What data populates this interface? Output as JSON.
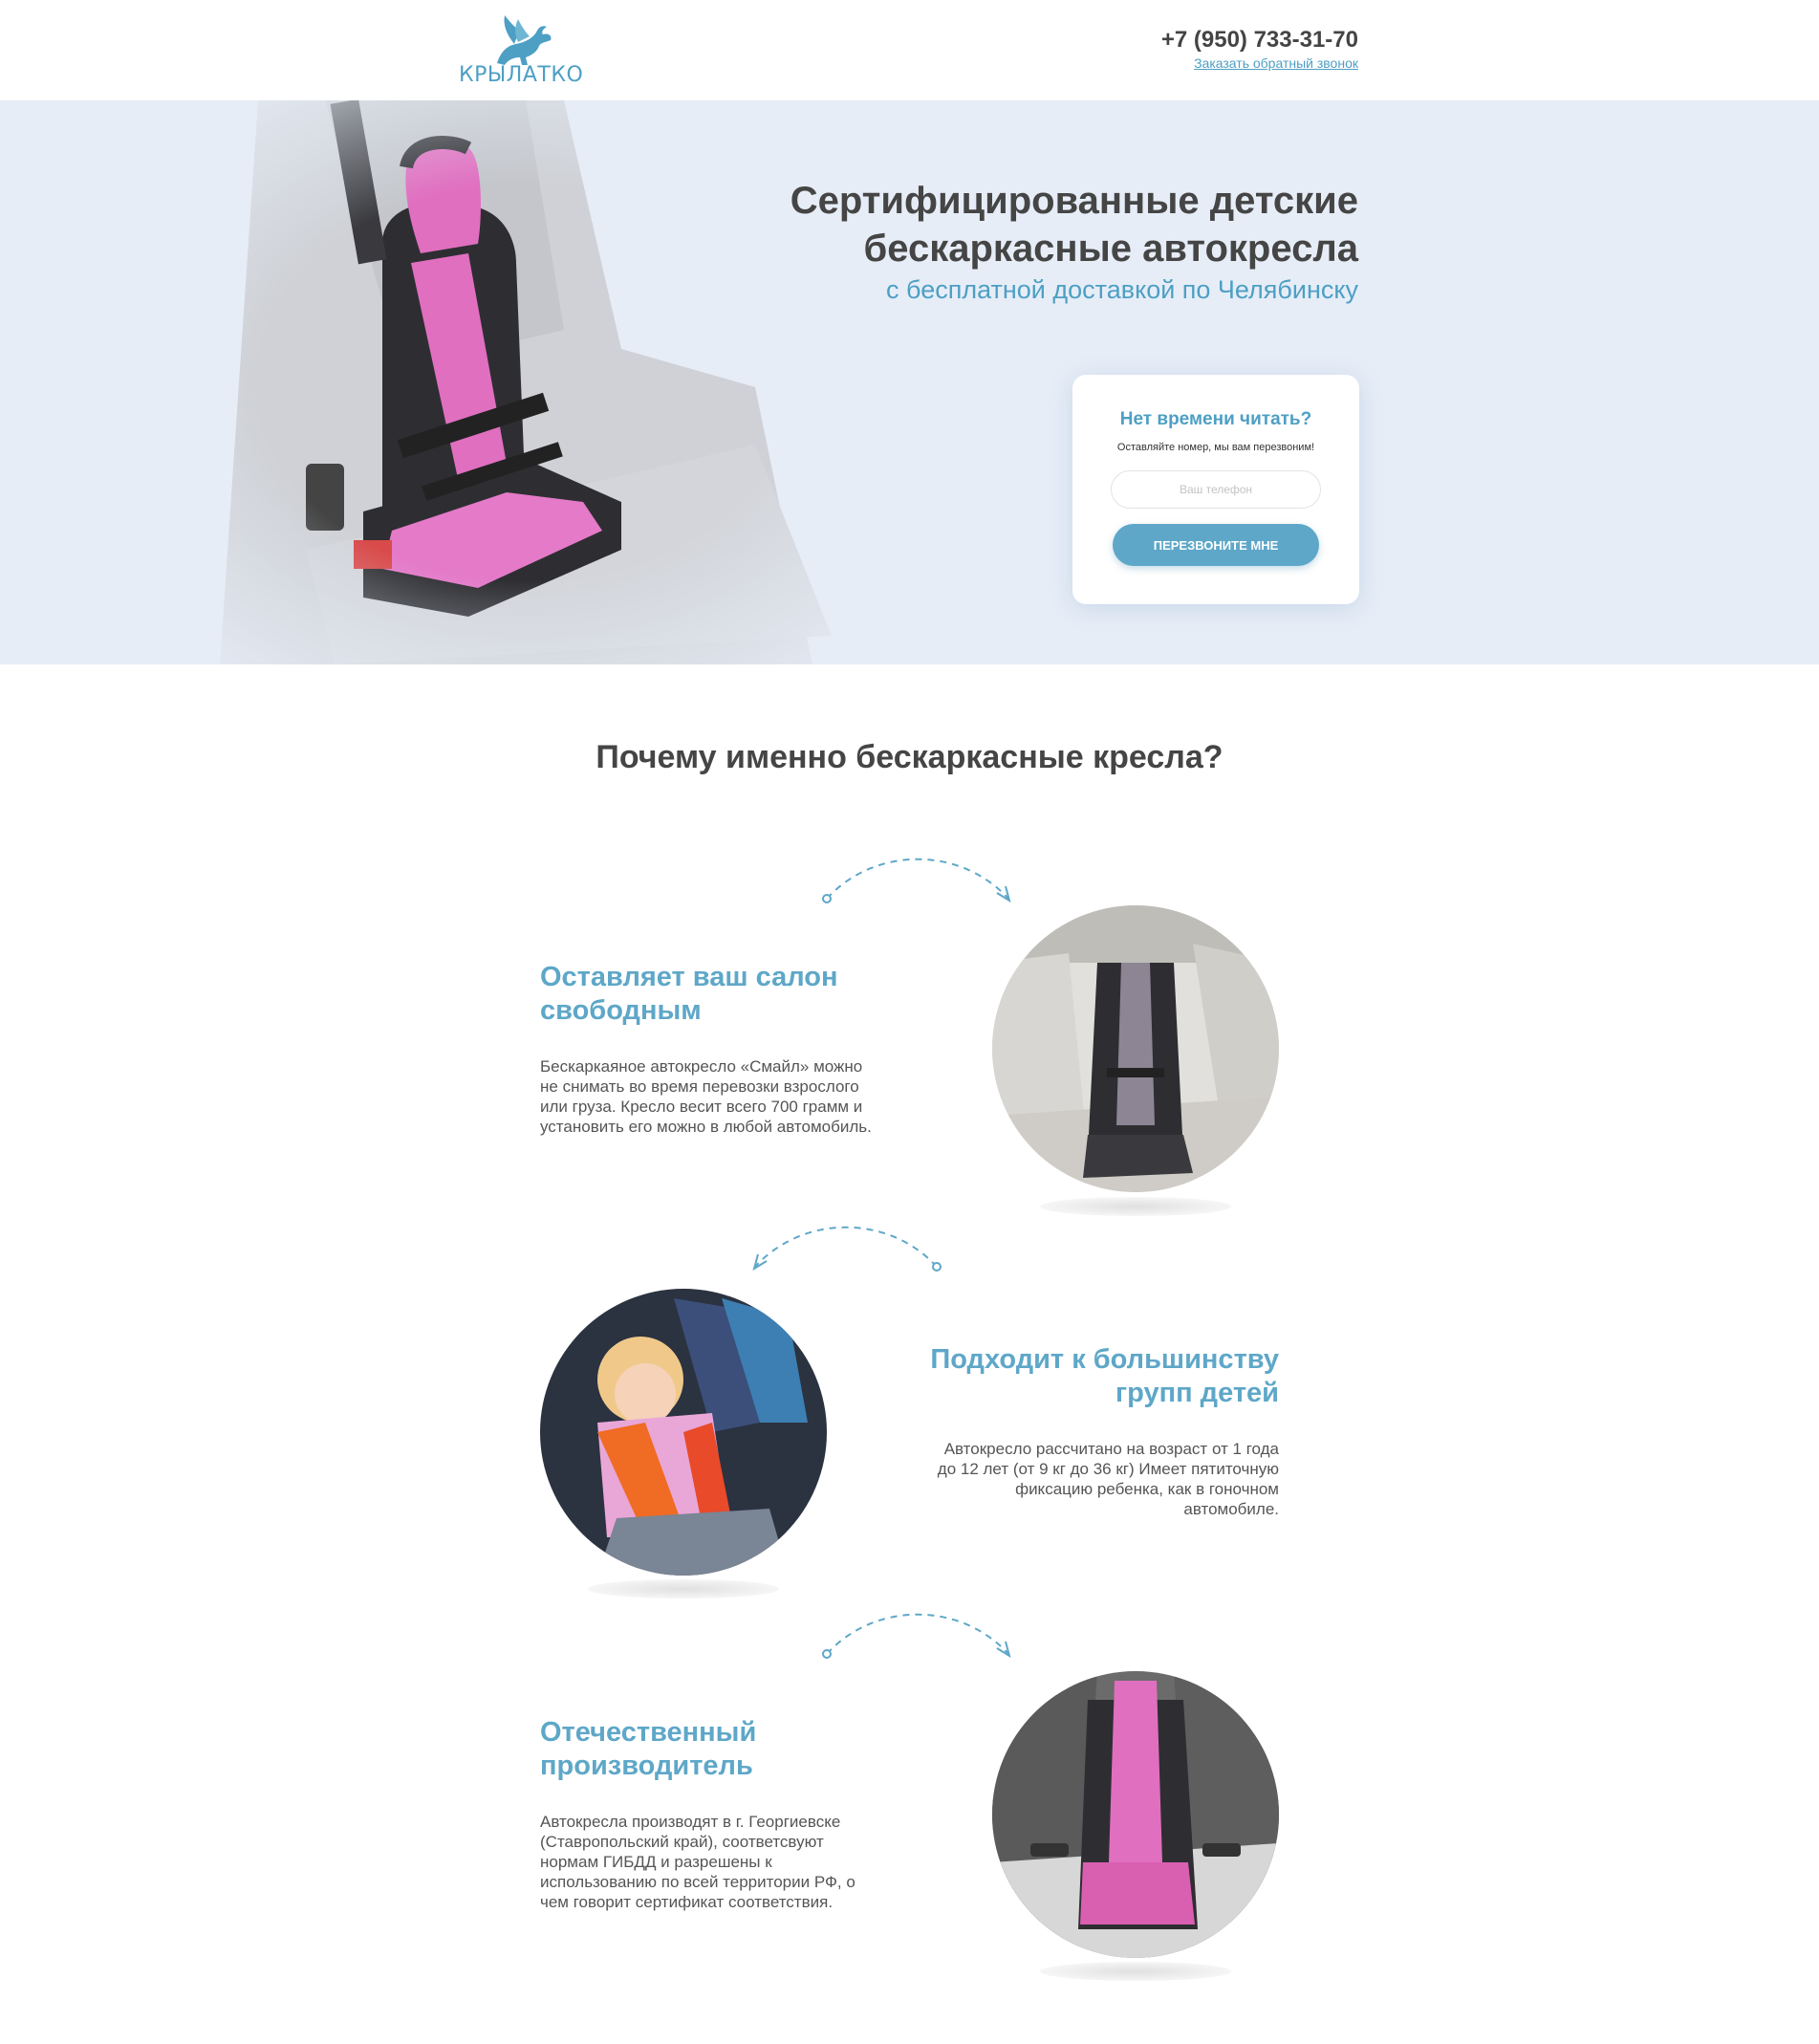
{
  "header": {
    "logo_text": "КРЫЛАТКО",
    "phone": "+7 (950) 733-31-70",
    "callback_link": "Заказать обратный звонок"
  },
  "hero": {
    "title_line1": "Сертифицированные детские",
    "title_line2": "бескаркасные автокресла",
    "subtitle": "с бесплатной доставкой по Челябинску",
    "form": {
      "title": "Нет времени читать?",
      "subtitle": "Оставляйте номер, мы вам перезвоним!",
      "phone_placeholder": "Ваш телефон",
      "submit_label": "ПЕРЕЗВОНИТЕ МНЕ"
    }
  },
  "why": {
    "title": "Почему именно бескаркасные кресла?",
    "features": [
      {
        "title_line1": "Оставляет ваш салон",
        "title_line2": "свободным",
        "text_lines": [
          "Бескаркаяное автокресло «Смайл» можно",
          "не снимать во время перевозки взрослого",
          "или груза. Кресло весит всего 700 грамм и",
          "установить его можно в любой автомобиль."
        ]
      },
      {
        "title_line1": "Подходит к большинству",
        "title_line2": "групп детей",
        "text_lines": [
          "Автокресло рассчитано на возраст от 1 года",
          "до 12 лет (от 9 кг до 36 кг) Имеет пятиточную",
          "фиксацию ребенка, как в гоночном",
          "автомобиле."
        ]
      },
      {
        "title_line1": "Отечественный",
        "title_line2": "производитель",
        "text_lines": [
          "Автокресла производят в г. Георгиевске",
          "(Ставропольский край), соответсвуют",
          "нормам ГИБДД и разрешены к",
          "использованию по всей территории РФ, о",
          "чем говорит сертификат соответствия."
        ]
      }
    ]
  },
  "colors": {
    "accent": "#5ea7c8",
    "hero_bg": "#e6edf7",
    "seat_pink": "#e06fc0",
    "seat_black": "#2e2e32"
  },
  "icons": [
    "pegasus-logo-icon",
    "dashed-arc-arrow-icon"
  ]
}
